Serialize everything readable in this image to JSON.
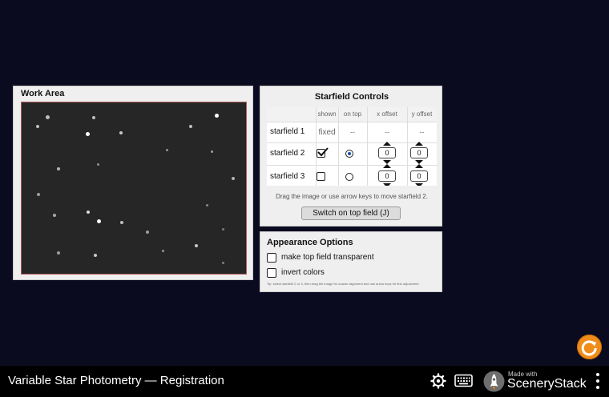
{
  "work_area": {
    "title": "Work Area"
  },
  "starfield_controls": {
    "title": "Starfield Controls",
    "columns": [
      "shown",
      "on top",
      "x offset",
      "y offset"
    ],
    "rows": [
      {
        "label": "starfield 1",
        "shown": "fixed",
        "on_top": "--",
        "x_offset": "--",
        "y_offset": "--"
      },
      {
        "label": "starfield 2",
        "shown": true,
        "on_top": true,
        "x_offset": "0",
        "y_offset": "0"
      },
      {
        "label": "starfield 3",
        "shown": false,
        "on_top": false,
        "x_offset": "0",
        "y_offset": "0"
      }
    ],
    "hint": "Drag the image or use arrow keys to move starfield 2.",
    "switch_button": "Switch on top field  (J)"
  },
  "appearance_options": {
    "title": "Appearance Options",
    "options": [
      {
        "label": "make top field transparent",
        "checked": false
      },
      {
        "label": "invert colors",
        "checked": false
      }
    ],
    "tip": "Tip: select starfield 2 or 3, then drag the image for coarse alignment and use arrow keys for fine adjustment."
  },
  "navbar": {
    "title": "Variable Star Photometry — Registration",
    "brand_small": "Made with",
    "brand_large": "SceneryStack"
  },
  "icons": {
    "settings": "gear-icon",
    "keyboard": "keyboard-icon",
    "brand": "rocket-icon",
    "menu": "kebab-menu-icon",
    "reset": "reset-icon"
  },
  "colors": {
    "background": "#0b0b20",
    "reset_button": "#f08c1a",
    "starfield_border": "#b05a5a"
  }
}
